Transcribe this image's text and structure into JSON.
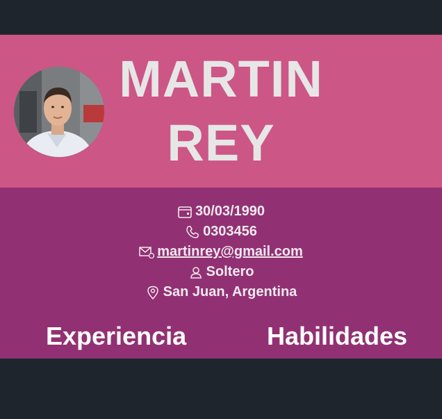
{
  "header": {
    "first_name": "MARTIN",
    "last_name": "REY",
    "avatar_icon": "profile-photo"
  },
  "info": {
    "birthdate": "30/03/1990",
    "phone": "0303456",
    "email": " martinrey@gmail.com",
    "status": "Soltero",
    "location": "San Juan, Argentina",
    "icons": [
      "calendar-icon",
      "phone-icon",
      "email-icon",
      "person-icon",
      "location-pin-icon"
    ]
  },
  "sections": {
    "experience": "Experiencia",
    "skills": "Habilidades"
  },
  "colors": {
    "background": "#1f252d",
    "header": "#cc5685",
    "info": "#913173",
    "name_text": "#e6e6e6"
  }
}
